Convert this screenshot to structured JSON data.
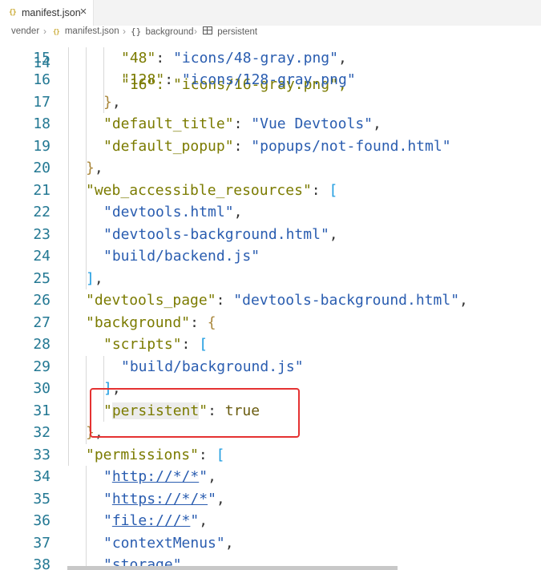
{
  "tab": {
    "icon": "{}",
    "label": "manifest.json",
    "close": "×"
  },
  "breadcrumb": {
    "items": [
      "vender",
      "manifest.json",
      "background",
      "persistent"
    ],
    "json_icon": "{}",
    "object_icon": "{}",
    "separator": "›"
  },
  "editor": {
    "partial_top_line": {
      "number": "14",
      "text": "\"16\": \"icons/16-gray.png\","
    },
    "lines": [
      {
        "number": "15",
        "indent": 2,
        "key": "48",
        "value": "icons/48-gray.png",
        "trail": ","
      },
      {
        "number": "16",
        "indent": 2,
        "key": "128",
        "value": "icons/128-gray.png",
        "trail": ""
      },
      {
        "number": "17",
        "indent": 1,
        "text": "},"
      },
      {
        "number": "18",
        "indent": 1,
        "key": "default_title",
        "value": "Vue Devtools",
        "trail": ","
      },
      {
        "number": "19",
        "indent": 1,
        "key": "default_popup",
        "value": "popups/not-found.html",
        "trail": ""
      },
      {
        "number": "20",
        "indent": 0,
        "text": "},"
      },
      {
        "number": "21",
        "indent": 0,
        "key": "web_accessible_resources",
        "open": "["
      },
      {
        "number": "22",
        "indent": 1,
        "value": "devtools.html",
        "trail": ","
      },
      {
        "number": "23",
        "indent": 1,
        "value": "devtools-background.html",
        "trail": ","
      },
      {
        "number": "24",
        "indent": 1,
        "value": "build/backend.js",
        "trail": ""
      },
      {
        "number": "25",
        "indent": 0,
        "text": "],"
      },
      {
        "number": "26",
        "indent": 0,
        "key": "devtools_page",
        "value": "devtools-background.html",
        "trail": ","
      },
      {
        "number": "27",
        "indent": 0,
        "key": "background",
        "open": "{"
      },
      {
        "number": "28",
        "indent": 1,
        "key": "scripts",
        "open": "["
      },
      {
        "number": "29",
        "indent": 2,
        "value": "build/background.js",
        "trail": ""
      },
      {
        "number": "30",
        "indent": 1,
        "text": "],"
      },
      {
        "number": "31",
        "indent": 1,
        "key": "persistent",
        "literal": "true"
      },
      {
        "number": "32",
        "indent": 0,
        "text": "},"
      },
      {
        "number": "33",
        "indent": 0,
        "key": "permissions",
        "open": "["
      },
      {
        "number": "34",
        "indent": 1,
        "value": "http://*/*",
        "trail": ","
      },
      {
        "number": "35",
        "indent": 1,
        "value": "https://*/*",
        "trail": ","
      },
      {
        "number": "36",
        "indent": 1,
        "value": "file:///*",
        "trail": ","
      },
      {
        "number": "37",
        "indent": 1,
        "value": "contextMenus",
        "trail": ","
      },
      {
        "number": "38",
        "indent": 1,
        "value": "storage",
        "trail": ""
      }
    ]
  },
  "colors": {
    "line_number": "#237893",
    "key": "#7b7b00",
    "string_value": "#2a5db0",
    "highlight_box": "#e53232"
  }
}
